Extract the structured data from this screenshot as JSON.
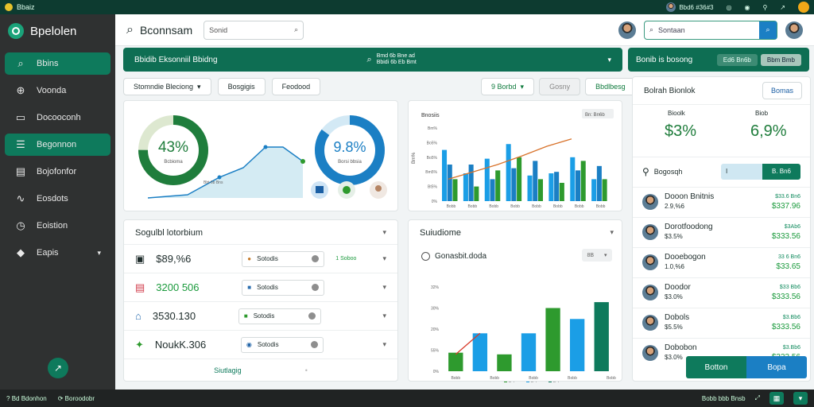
{
  "topbar": {
    "app_name": "Bbaiz",
    "right_text": "Bbd6 #36#3"
  },
  "sidebar": {
    "brand": "Bpelolen",
    "items": [
      {
        "label": "Bbins",
        "icon": "search-icon",
        "active": true
      },
      {
        "label": "Voonda",
        "icon": "compass-icon",
        "active": false
      },
      {
        "label": "Docooconh",
        "icon": "ticket-icon",
        "active": false
      },
      {
        "label": "Begonnon",
        "icon": "list-icon",
        "active": true
      },
      {
        "label": "Bojofonfor",
        "icon": "document-icon",
        "active": false
      },
      {
        "label": "Eosdots",
        "icon": "route-icon",
        "active": false
      },
      {
        "label": "Eoistion",
        "icon": "clock-icon",
        "active": false
      },
      {
        "label": "Eapis",
        "icon": "tag-icon",
        "active": false,
        "expandable": true
      }
    ],
    "fab_icon": "arrow-icon"
  },
  "header": {
    "title": "Bconnsam",
    "search_small_placeholder": "Sonid",
    "search_large_placeholder": "Sontaan"
  },
  "banner": {
    "title": "Bbidib Eksonniil Bbidng",
    "mid_line1": "Bmd 6b Bne ad",
    "mid_line2": "Bbidi 6b Eb Bmt",
    "right_title": "Bonib is bosong",
    "right_btn1": "Ed6 Bn6b",
    "right_btn2": "Bbm Bmb"
  },
  "toolbar": {
    "sort": "Stomndie Bleciong",
    "b2": "Bosgigis",
    "b3": "Feodood",
    "filter": "9 Borbd",
    "b5": "Gosny",
    "b6": "Bbdlbesg"
  },
  "donuts": [
    {
      "value": "43%",
      "sub": "Bcbioma",
      "progress": 0.75,
      "color": "#1f7d3c"
    },
    {
      "value": "9.8%",
      "sub": "Borsi bbsia",
      "progress": 0.85,
      "color": "#1b7fc4"
    }
  ],
  "donut_line": {
    "label": "Bbt 6b Bns"
  },
  "bar_chart1": {
    "chart_data": {
      "type": "bar",
      "title": "Bnosiis",
      "legend_label": "Bn: Bn6b",
      "yticks": [
        "Bm%",
        "Bo5%",
        "Bo5%",
        "Bm5%",
        "Bt5%",
        "0%"
      ],
      "categories": [
        "Bobb",
        "Bobb",
        "Bobb",
        "Bobb",
        "Bobb",
        "Bobb",
        "Bobb",
        "Bobb"
      ],
      "series": [
        {
          "color": "#1b9ee6",
          "values": [
            0.7,
            0.38,
            0.58,
            0.78,
            0.35,
            0.38,
            0.6,
            0.3
          ]
        },
        {
          "color": "#1b7fc4",
          "values": [
            0.5,
            0.5,
            0.3,
            0.45,
            0.55,
            0.4,
            0.42,
            0.48
          ]
        },
        {
          "color": "#2e9a2e",
          "values": [
            0.3,
            0.2,
            0.42,
            0.6,
            0.3,
            0.25,
            0.55,
            0.3
          ]
        }
      ],
      "trend": [
        0.3,
        0.4,
        0.5,
        0.62,
        0.75,
        0.85
      ]
    }
  },
  "social_panel": {
    "title": "Sogulbl lotorbium",
    "rows": [
      {
        "amount": "$89,%6",
        "amount_color": "#1d2b2a",
        "label": "Sotodis",
        "badge": "1 Soboo",
        "icon": "wallet-icon"
      },
      {
        "amount": "3200 506",
        "amount_color": "#1a9a3c",
        "label": "Sotodis",
        "badge": "",
        "icon": "bag-icon"
      },
      {
        "amount": "3530.130",
        "amount_color": "#1d2b2a",
        "label": "Sotodis",
        "badge": "",
        "icon": "cart-icon"
      },
      {
        "amount": "NoukK.306",
        "amount_color": "#1d2b2a",
        "label": "Sotodis",
        "badge": "",
        "icon": "leaf-icon"
      }
    ],
    "footer_link": "Siutlagig"
  },
  "stat_panel": {
    "title": "Suiudiome",
    "radio_label": "Gonasbit.doda",
    "select_value": "8B",
    "chart_data": {
      "type": "bar",
      "yticks": [
        "32%",
        "30%",
        "20%",
        "55%",
        "0%"
      ],
      "categories": [
        "Bobb",
        "Bobb",
        "Bobb",
        "Bobb",
        "Bobb",
        "Bobb",
        "Bobb"
      ],
      "series": [
        {
          "color": "#2e9a2e",
          "values": [
            0.22,
            0.0,
            0.2,
            0.0,
            0.75,
            0.0,
            0.0
          ]
        },
        {
          "color": "#1b9ee6",
          "values": [
            0.0,
            0.45,
            0.0,
            0.45,
            0.0,
            0.62,
            0.0
          ]
        },
        {
          "color": "#0e7a5c",
          "values": [
            0.0,
            0.0,
            0.0,
            0.0,
            0.0,
            0.0,
            0.82
          ]
        }
      ],
      "legend": [
        "Bob",
        "Bob",
        "Bob"
      ]
    }
  },
  "right_panel": {
    "title": "Bolrah Bionlok",
    "button": "Bomas",
    "stat1_label": "Bioolk",
    "stat1_value": "$3%",
    "stat2_label": "Biob",
    "stat2_value": "6,9%",
    "search_label": "Bogosqh",
    "search_btn": "B. Bn6",
    "contacts": [
      {
        "name": "Dooon Bnitnis",
        "value": "2.9,%6",
        "amount": "$337.96",
        "sub": "$33.6 Bn6"
      },
      {
        "name": "Dorotfoodong",
        "value": "$3.5%",
        "amount": "$333.56",
        "sub": "$3Ab6"
      },
      {
        "name": "Dooebogon",
        "value": "1.0,%6",
        "amount": "$33.65",
        "sub": "33 6 Bn6"
      },
      {
        "name": "Doodor",
        "value": "$3.0%",
        "amount": "$333.56",
        "sub": "$33 Bb6"
      },
      {
        "name": "Dobols",
        "value": "$5.5%",
        "amount": "$333.56",
        "sub": "$3.Bb6"
      },
      {
        "name": "Dobobon",
        "value": "$3.0%",
        "amount": "$333.56",
        "sub": "$3.Bb6"
      }
    ]
  },
  "bottom_buttons": {
    "left": "Botton",
    "right": "Bopa"
  },
  "bottombar": {
    "left1": "Bd Bdonhon",
    "left2": "Boroodobr",
    "right": "Bobb bbb Bnsb"
  }
}
